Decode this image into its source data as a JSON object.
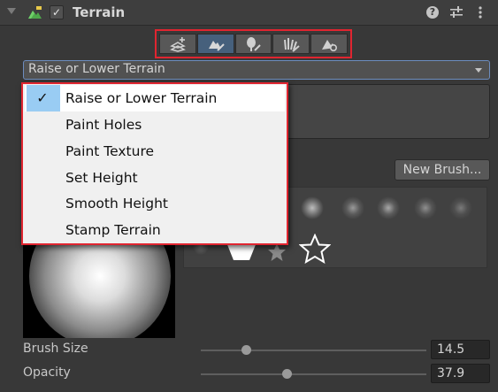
{
  "header": {
    "title": "Terrain",
    "enabled_check": "✓",
    "help_symbol": "?",
    "collapse_icon": "triangle-down-icon",
    "component_icon": "terrain-icon",
    "presets_icon": "presets-sliders-icon",
    "menu_icon": "kebab-menu-icon"
  },
  "toolbar": {
    "tools": [
      {
        "name": "create-neighbor-terrains",
        "icon": "terrain-add-icon",
        "active": false
      },
      {
        "name": "paint-terrain",
        "icon": "terrain-paint-icon",
        "active": true
      },
      {
        "name": "paint-trees",
        "icon": "tree-paint-icon",
        "active": false
      },
      {
        "name": "paint-details",
        "icon": "grass-paint-icon",
        "active": false
      },
      {
        "name": "terrain-settings",
        "icon": "terrain-gear-icon",
        "active": false
      }
    ],
    "active_color": "#46607c",
    "highlight_color": "#e02530"
  },
  "dropdown": {
    "value": "Raise or Lower Terrain",
    "options": [
      "Raise or Lower Terrain",
      "Paint Holes",
      "Paint Texture",
      "Set Height",
      "Smooth Height",
      "Stamp Terrain"
    ],
    "selected_check": "✓"
  },
  "brushes": {
    "new_brush_label": "New Brush..."
  },
  "settings": {
    "brush_size_label": "Brush Size",
    "brush_size_value": "14.5",
    "brush_size_fraction": 0.19,
    "opacity_label": "Opacity",
    "opacity_value": "37.9",
    "opacity_fraction": 0.379
  }
}
